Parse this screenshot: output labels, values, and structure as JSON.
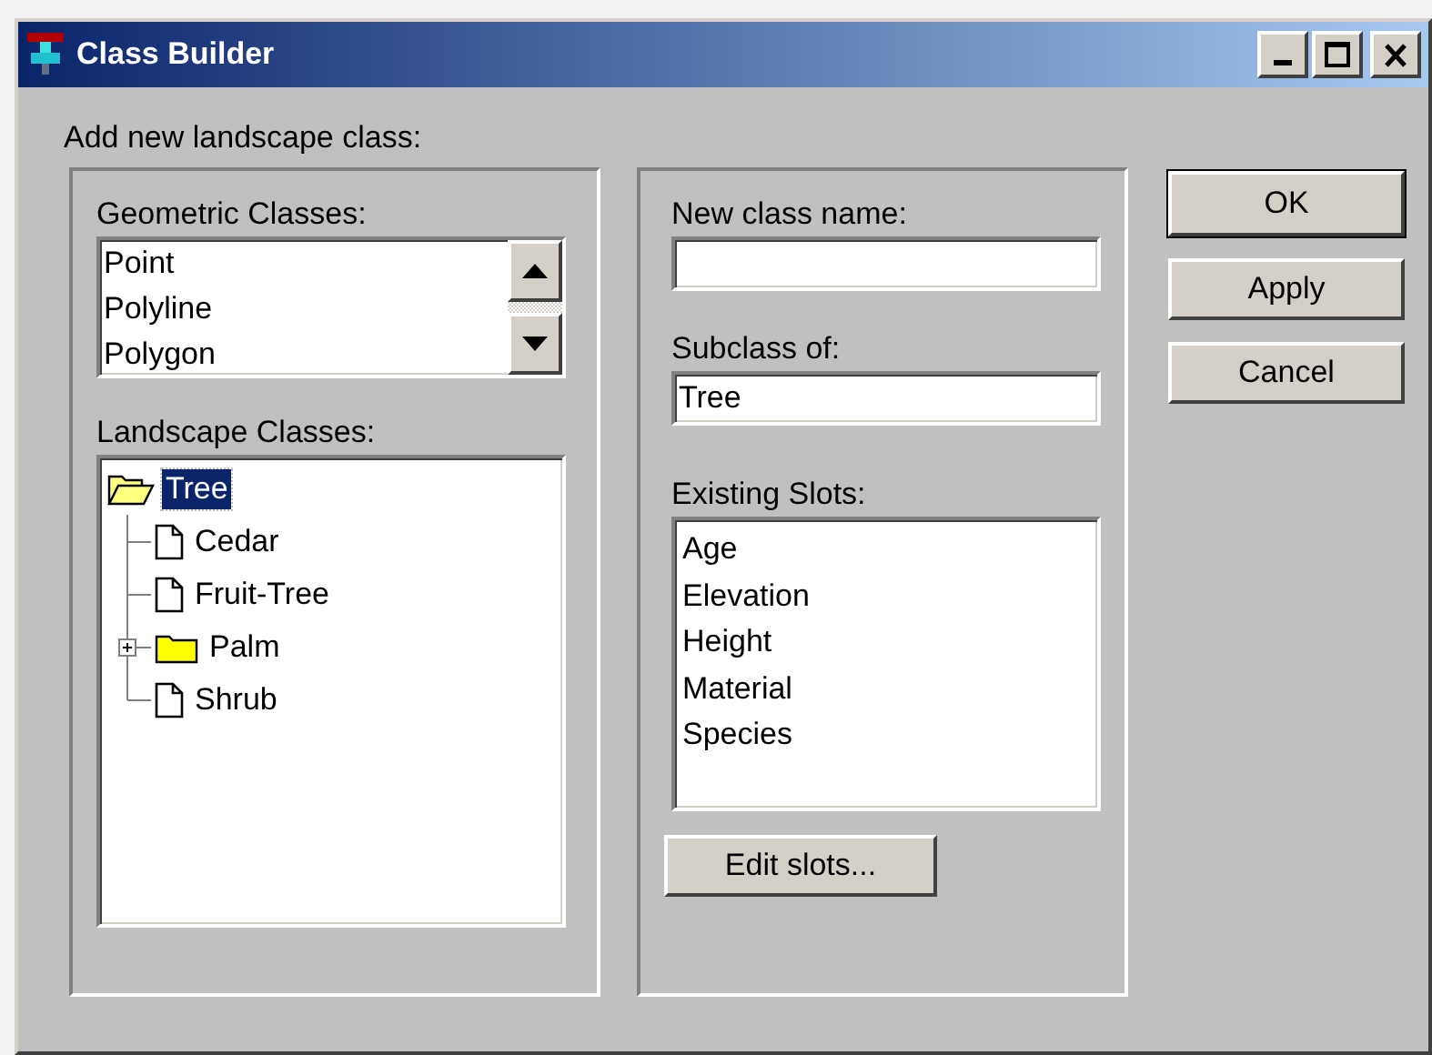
{
  "window": {
    "title": "Class Builder"
  },
  "prompt": "Add new landscape class:",
  "geometric_classes": {
    "label": "Geometric Classes:",
    "items": [
      {
        "label": "Point",
        "selected": false
      },
      {
        "label": "Polyline",
        "selected": false
      },
      {
        "label": "Polygon",
        "selected": false
      }
    ]
  },
  "landscape_classes": {
    "label": "Landscape Classes:",
    "tree": [
      {
        "label": "Tree",
        "kind": "folder",
        "expanded": true,
        "selected": true,
        "children": [
          {
            "label": "Cedar",
            "kind": "leaf",
            "selected": false
          },
          {
            "label": "Fruit-Tree",
            "kind": "leaf",
            "selected": false
          },
          {
            "label": "Palm",
            "kind": "folder",
            "expanded": false,
            "selected": false
          },
          {
            "label": "Shrub",
            "kind": "leaf",
            "selected": false
          }
        ]
      }
    ]
  },
  "new_class_name": {
    "label": "New class name:"
  },
  "subclass_of": {
    "label": "Subclass of:",
    "value": "Tree"
  },
  "existing_slots": {
    "label": "Existing Slots:",
    "items": [
      {
        "label": "Age",
        "selected": false
      },
      {
        "label": "Elevation",
        "selected": false
      },
      {
        "label": "Height",
        "selected": false
      },
      {
        "label": "Material",
        "selected": false
      },
      {
        "label": "Species",
        "selected": false
      }
    ]
  },
  "edit_slots_button": "Edit slots...",
  "buttons": [
    {
      "label": "OK",
      "default": true
    },
    {
      "label": "Apply",
      "default": false
    },
    {
      "label": "Cancel",
      "default": false
    }
  ]
}
